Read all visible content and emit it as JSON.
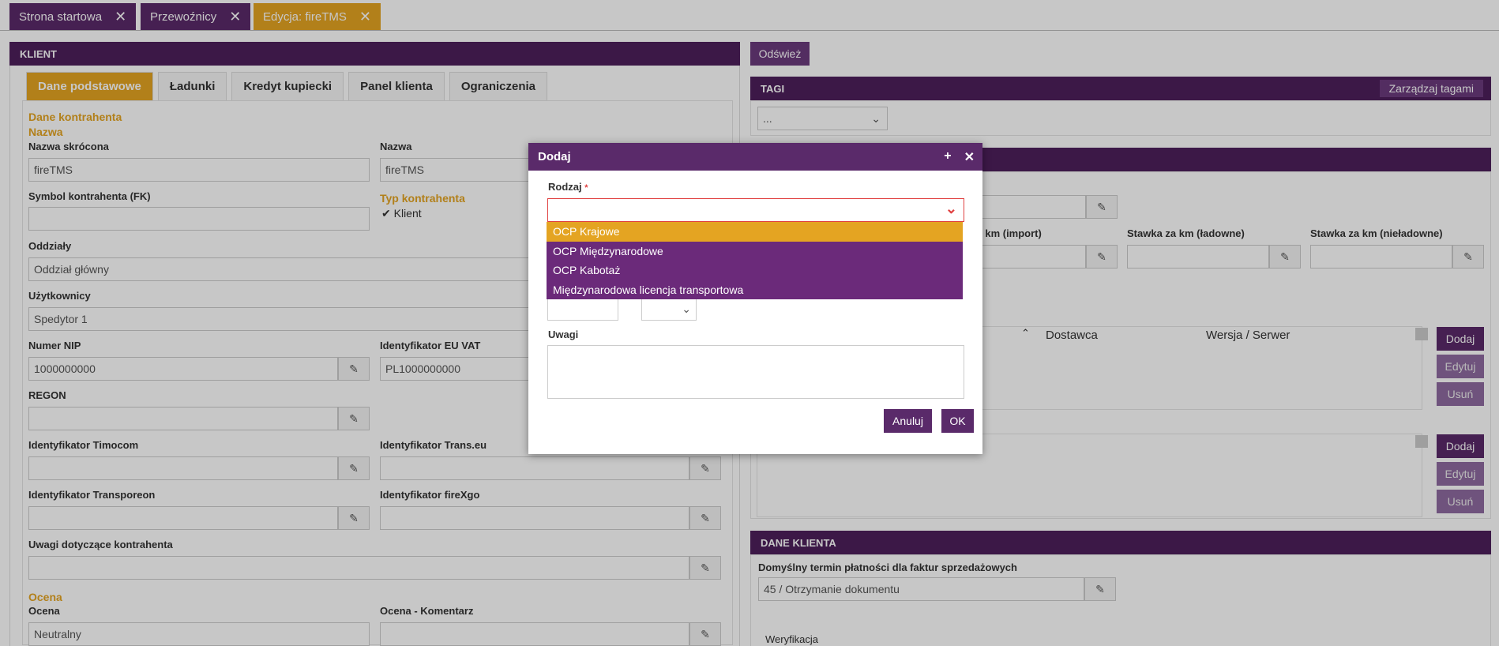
{
  "tabs": [
    {
      "label": "Strona startowa"
    },
    {
      "label": "Przewoźnicy"
    },
    {
      "label": "Edycja: fireTMS"
    }
  ],
  "close_glyph": "✕",
  "left": {
    "header": "KLIENT",
    "subtabs": [
      "Dane podstawowe",
      "Ładunki",
      "Kredyt kupiecki",
      "Panel klienta",
      "Ograniczenia"
    ],
    "section1": "Dane kontrahenta",
    "section1_sub": "Nazwa",
    "fields": {
      "nazwa_skrocona": {
        "label": "Nazwa skrócona",
        "value": "fireTMS"
      },
      "nazwa": {
        "label": "Nazwa",
        "value": "fireTMS"
      },
      "symbol": {
        "label": "Symbol kontrahenta (FK)",
        "value": ""
      },
      "typ": {
        "label": "Typ kontrahenta",
        "value": "✔ Klient"
      },
      "oddzialy": {
        "label": "Oddziały",
        "value": "Oddział główny"
      },
      "uzytkownicy": {
        "label": "Użytkownicy",
        "value": "Spedytor 1"
      },
      "nip": {
        "label": "Numer NIP",
        "value": "1000000000"
      },
      "euvat": {
        "label": "Identyfikator EU VAT",
        "value": "PL1000000000"
      },
      "regon": {
        "label": "REGON",
        "value": ""
      },
      "timocom": {
        "label": "Identyfikator Timocom",
        "value": ""
      },
      "transeu": {
        "label": "Identyfikator Trans.eu",
        "value": ""
      },
      "transporeon": {
        "label": "Identyfikator Transporeon",
        "value": ""
      },
      "firexgo": {
        "label": "Identyfikator fireXgo",
        "value": ""
      },
      "uwagi": {
        "label": "Uwagi dotyczące kontrahenta",
        "value": ""
      },
      "ocena": {
        "label": "Ocena",
        "value": "Neutralny"
      },
      "ocena_kom": {
        "label": "Ocena - Komentarz",
        "value": ""
      }
    },
    "section2": "Ocena"
  },
  "right": {
    "refresh": "Odśwież",
    "tagi_header": "TAGI",
    "tagi_manage": "Zarządzaj tagami",
    "tagi_select": "...",
    "rates": [
      "za km (import)",
      "Stawka za km (ładowne)",
      "Stawka za km (nieładowne)"
    ],
    "table_cols": [
      "Dostawca",
      "Wersja / Serwer"
    ],
    "btn_add": "Dodaj",
    "btn_edit": "Edytuj",
    "btn_delete": "Usuń",
    "dane_header": "DANE KLIENTA",
    "termin_label": "Domyślny termin płatności dla faktur sprzedażowych",
    "termin_value": "45 / Otrzymanie dokumentu",
    "weryfikacja": "Weryfikacja"
  },
  "dialog": {
    "title": "Dodaj",
    "plus": "+",
    "close": "✕",
    "rodzaj_label": "Rodzaj",
    "required": "*",
    "options": [
      "OCP Krajowe",
      "OCP Międzynarodowe",
      "OCP Kabotaż",
      "Międzynarodowa licencja transportowa"
    ],
    "uwagi_label": "Uwagi",
    "cancel": "Anuluj",
    "ok": "OK"
  },
  "colors": {
    "purple": "#5a2a6a",
    "orange": "#e4a422",
    "red": "#e04040"
  }
}
